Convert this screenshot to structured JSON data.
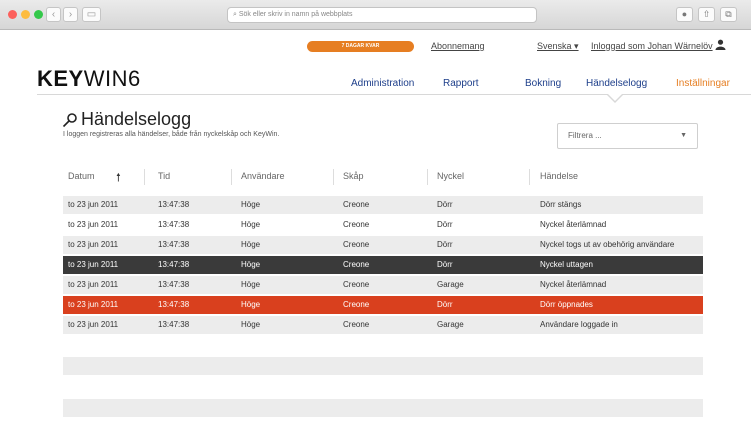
{
  "browser": {
    "address_placeholder": "Sök eller skriv in namn på webbplats",
    "back_icon": "chevron-left",
    "forward_icon": "chevron-right"
  },
  "header": {
    "trial_badge": "7 DAGAR KVAR",
    "subscription_link": "Abonnemang",
    "language": "Svenska ▾",
    "logged_in": "Inloggad som Johan Wärnelöv",
    "logo_bold": "KEY",
    "logo_thin": "WIN6"
  },
  "nav": [
    "Administration",
    "Rapport",
    "Bokning",
    "Händelselogg",
    "Inställningar"
  ],
  "page": {
    "title": "Händelselogg",
    "subtitle": "I loggen registreras alla händelser, både från nyckelskåp och KeyWin.",
    "filter_placeholder": "Filtrera ...",
    "filter_arrow": "▼"
  },
  "table": {
    "headers": [
      "Datum",
      "Tid",
      "Användare",
      "Skåp",
      "Nyckel",
      "Händelse"
    ],
    "sort_icon": "🠕",
    "rows": [
      {
        "datum": "to 23 jun 2011",
        "tid": "13:47:38",
        "anvandare": "Höge",
        "skap": "Creone",
        "nyckel": "Dörr",
        "handelse": "Dörr stängs",
        "style": "odd"
      },
      {
        "datum": "to 23 jun 2011",
        "tid": "13:47:38",
        "anvandare": "Höge",
        "skap": "Creone",
        "nyckel": "Dörr",
        "handelse": "Nyckel återlämnad",
        "style": "even"
      },
      {
        "datum": "to 23 jun 2011",
        "tid": "13:47:38",
        "anvandare": "Höge",
        "skap": "Creone",
        "nyckel": "Dörr",
        "handelse": "Nyckel togs ut av obehörig användare",
        "style": "odd"
      },
      {
        "datum": "to 23 jun 2011",
        "tid": "13:47:38",
        "anvandare": "Höge",
        "skap": "Creone",
        "nyckel": "Dörr",
        "handelse": "Nyckel uttagen",
        "style": "dark"
      },
      {
        "datum": "to 23 jun 2011",
        "tid": "13:47:38",
        "anvandare": "Höge",
        "skap": "Creone",
        "nyckel": "Garage",
        "handelse": "Nyckel återlämnad",
        "style": "odd"
      },
      {
        "datum": "to 23 jun 2011",
        "tid": "13:47:38",
        "anvandare": "Höge",
        "skap": "Creone",
        "nyckel": "Dörr",
        "handelse": "Dörr öppnades",
        "style": "red"
      },
      {
        "datum": "to 23 jun 2011",
        "tid": "13:47:38",
        "anvandare": "Höge",
        "skap": "Creone",
        "nyckel": "Garage",
        "handelse": "Användare loggade in",
        "style": "odd"
      }
    ]
  },
  "colors": {
    "accent_orange": "#e67e22",
    "nav_blue": "#1d3e8a",
    "alert_red": "#d9401e",
    "selected_dark": "#3a3a3a"
  }
}
